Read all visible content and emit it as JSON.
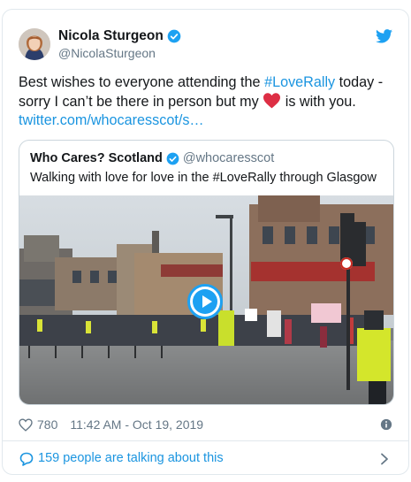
{
  "author": {
    "name": "Nicola Sturgeon",
    "handle": "@NicolaSturgeon"
  },
  "tweet": {
    "text_before": "Best wishes to everyone attending the ",
    "hashtag": "#LoveRally",
    "text_after": " today - sorry I can’t be there in person but my ",
    "text_end": " is with you.",
    "link": "twitter.com/whocaresscot/s…"
  },
  "quoted": {
    "name": "Who Cares? Scotland",
    "handle": "@whocaresscot",
    "text": "Walking with love for love in the #LoveRally through Glasgow"
  },
  "meta": {
    "likes": "780",
    "timestamp": "11:42 AM - Oct 19, 2019"
  },
  "footer": {
    "talking": "159 people are talking about this"
  },
  "colors": {
    "accent": "#1da1f2",
    "link": "#1b95e0",
    "muted": "#657786"
  },
  "icons": [
    "verified-badge-icon",
    "twitter-bird-icon",
    "heart-emoji-icon",
    "play-icon",
    "like-heart-icon",
    "info-icon",
    "speech-bubble-icon",
    "chevron-right-icon"
  ]
}
